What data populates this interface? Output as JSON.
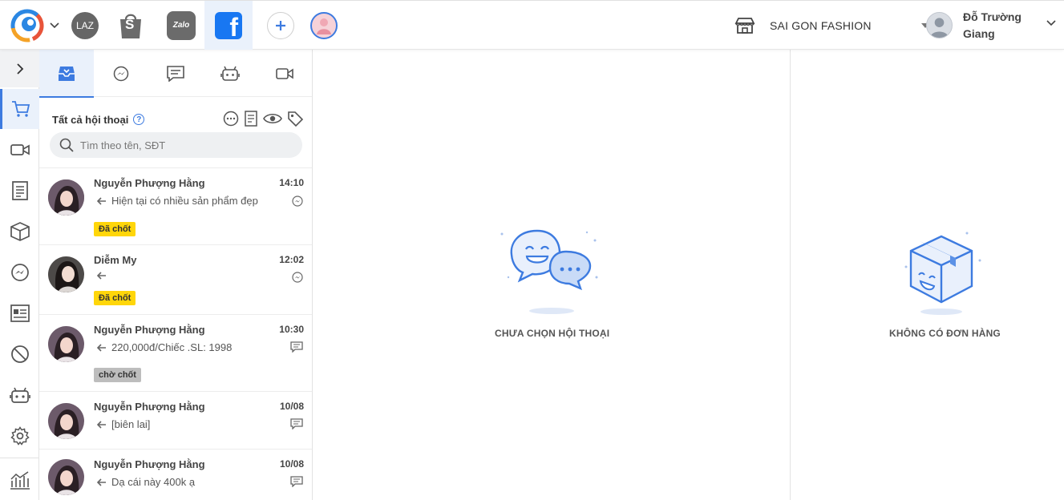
{
  "topbar": {
    "channels": [
      {
        "name": "lazada",
        "label": "LAZ"
      },
      {
        "name": "shopee",
        "label": "S"
      },
      {
        "name": "zalo",
        "label": "Zalo"
      },
      {
        "name": "facebook",
        "label": "f"
      }
    ],
    "store_name": "SAI GON FASHION",
    "user_name": "Đỗ Trường Giang"
  },
  "tabs": [
    "inbox-icon",
    "messenger-icon",
    "comment-icon",
    "bot-icon",
    "video-icon"
  ],
  "filter": {
    "title": "Tất cả hội thoại",
    "help": "?"
  },
  "search": {
    "placeholder": "Tìm theo tên, SĐT"
  },
  "conversations": [
    {
      "name": "Nguyễn Phượng Hằng",
      "time": "14:10",
      "message": "Hiện tại có nhiều sản phẩm đẹp",
      "channel": "messenger",
      "tag": "Đã chốt"
    },
    {
      "name": "Diễm My",
      "time": "12:02",
      "message": "",
      "channel": "messenger",
      "tag": "Đã chốt"
    },
    {
      "name": "Nguyễn Phượng Hằng",
      "time": "10:30",
      "message": "220,000đ/Chiếc .SL: 1998",
      "channel": "comment",
      "tag": "chờ chốt"
    },
    {
      "name": "Nguyễn Phượng Hằng",
      "time": "10/08",
      "message": "[biên lai]",
      "channel": "comment",
      "tag": ""
    },
    {
      "name": "Nguyễn Phượng Hằng",
      "time": "10/08",
      "message": "Dạ cái này 400k ạ",
      "channel": "comment",
      "tag": ""
    }
  ],
  "center": {
    "empty_label": "CHƯA CHỌN HỘI THOẠI"
  },
  "right": {
    "empty_label": "KHÔNG CÓ ĐƠN HÀNG"
  },
  "colors": {
    "accent": "#3d7be0",
    "tag_done": "#ffd60a",
    "tag_wait": "#bdbdbd",
    "facebook": "#1877f2"
  }
}
